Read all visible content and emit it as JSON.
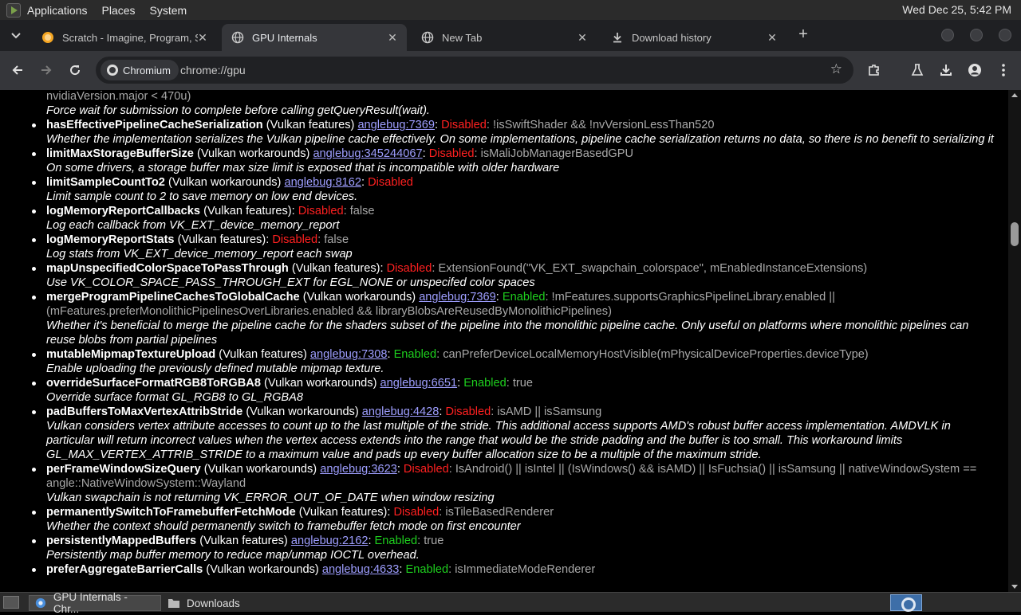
{
  "system_panel": {
    "menus": [
      "Applications",
      "Places",
      "System"
    ],
    "clock": "Wed Dec 25,  5:42 PM"
  },
  "tabs": [
    {
      "title": "Scratch - Imagine, Program, Share",
      "icon": "scratch-icon",
      "active": false
    },
    {
      "title": "GPU Internals",
      "icon": "globe-icon",
      "active": true
    },
    {
      "title": "New Tab",
      "icon": "globe-icon",
      "active": false
    },
    {
      "title": "Download history",
      "icon": "download-icon",
      "active": false
    }
  ],
  "toolbar": {
    "chip_label": "Chromium",
    "url": "chrome://gpu"
  },
  "content": {
    "top_partial_cond": "nvidiaVersion.major < 470u)",
    "top_partial_desc": "Force wait for submission to complete before calling getQueryResult(wait).",
    "features": [
      {
        "name": "hasEffectivePipelineCacheSerialization",
        "kind": "(Vulkan features)",
        "link": "anglebug:7369",
        "status": "Disabled",
        "cond": "!isSwiftShader && !nvVersionLessThan520",
        "desc": "Whether the implementation serializes the Vulkan pipeline cache effectively. On some implementations, pipeline cache serialization returns no data, so there is no benefit to serializing it"
      },
      {
        "name": "limitMaxStorageBufferSize",
        "kind": "(Vulkan workarounds)",
        "link": "anglebug:345244067",
        "status": "Disabled",
        "cond": "isMaliJobManagerBasedGPU",
        "desc": "On some drivers, a storage buffer max size limit is exposed that is incompatible with older hardware"
      },
      {
        "name": "limitSampleCountTo2",
        "kind": "(Vulkan workarounds)",
        "link": "anglebug:8162",
        "status": "Disabled",
        "cond": "",
        "desc": "Limit sample count to 2 to save memory on low end devices."
      },
      {
        "name": "logMemoryReportCallbacks",
        "kind": "(Vulkan features):",
        "link": "",
        "status": "Disabled",
        "cond": "false",
        "desc": "Log each callback from VK_EXT_device_memory_report"
      },
      {
        "name": "logMemoryReportStats",
        "kind": "(Vulkan features):",
        "link": "",
        "status": "Disabled",
        "cond": "false",
        "desc": "Log stats from VK_EXT_device_memory_report each swap"
      },
      {
        "name": "mapUnspecifiedColorSpaceToPassThrough",
        "kind": "(Vulkan features):",
        "link": "",
        "status": "Disabled",
        "cond": "ExtensionFound(\"VK_EXT_swapchain_colorspace\", mEnabledInstanceExtensions)",
        "desc": "Use VK_COLOR_SPACE_PASS_THROUGH_EXT for EGL_NONE or unspecifed color spaces"
      },
      {
        "name": "mergeProgramPipelineCachesToGlobalCache",
        "kind": "(Vulkan workarounds)",
        "link": "anglebug:7369",
        "status": "Enabled",
        "cond": "!mFeatures.supportsGraphicsPipelineLibrary.enabled || (mFeatures.preferMonolithicPipelinesOverLibraries.enabled && libraryBlobsAreReusedByMonolithicPipelines)",
        "desc": "Whether it's beneficial to merge the pipeline cache for the shaders subset of the pipeline into the monolithic pipeline cache. Only useful on platforms where monolithic pipelines can reuse blobs from partial pipelines"
      },
      {
        "name": "mutableMipmapTextureUpload",
        "kind": "(Vulkan features)",
        "link": "anglebug:7308",
        "status": "Enabled",
        "cond": "canPreferDeviceLocalMemoryHostVisible(mPhysicalDeviceProperties.deviceType)",
        "desc": "Enable uploading the previously defined mutable mipmap texture."
      },
      {
        "name": "overrideSurfaceFormatRGB8ToRGBA8",
        "kind": "(Vulkan workarounds)",
        "link": "anglebug:6651",
        "status": "Enabled",
        "cond": "true",
        "desc": "Override surface format GL_RGB8 to GL_RGBA8"
      },
      {
        "name": "padBuffersToMaxVertexAttribStride",
        "kind": "(Vulkan workarounds)",
        "link": "anglebug:4428",
        "status": "Disabled",
        "cond": "isAMD || isSamsung",
        "desc": "Vulkan considers vertex attribute accesses to count up to the last multiple of the stride. This additional access supports AMD's robust buffer access implementation. AMDVLK in particular will return incorrect values when the vertex access extends into the range that would be the stride padding and the buffer is too small. This workaround limits GL_MAX_VERTEX_ATTRIB_STRIDE to a maximum value and pads up every buffer allocation size to be a multiple of the maximum stride."
      },
      {
        "name": "perFrameWindowSizeQuery",
        "kind": "(Vulkan workarounds)",
        "link": "anglebug:3623",
        "status": "Disabled",
        "cond": "IsAndroid() || isIntel || (IsWindows() && isAMD) || IsFuchsia() || isSamsung || nativeWindowSystem == angle::NativeWindowSystem::Wayland",
        "desc": "Vulkan swapchain is not returning VK_ERROR_OUT_OF_DATE when window resizing"
      },
      {
        "name": "permanentlySwitchToFramebufferFetchMode",
        "kind": "(Vulkan features):",
        "link": "",
        "status": "Disabled",
        "cond": "isTileBasedRenderer",
        "desc": "Whether the context should permanently switch to framebuffer fetch mode on first encounter"
      },
      {
        "name": "persistentlyMappedBuffers",
        "kind": "(Vulkan features)",
        "link": "anglebug:2162",
        "status": "Enabled",
        "cond": "true",
        "desc": "Persistently map buffer memory to reduce map/unmap IOCTL overhead."
      },
      {
        "name": "preferAggregateBarrierCalls",
        "kind": "(Vulkan workarounds)",
        "link": "anglebug:4633",
        "status": "Enabled",
        "cond": "isImmediateModeRenderer",
        "desc": ""
      }
    ]
  },
  "taskbar": {
    "items": [
      {
        "label": "GPU Internals - Chr...",
        "icon": "chromium-icon",
        "active": true
      },
      {
        "label": "Downloads",
        "icon": "folder-icon",
        "active": false
      }
    ]
  },
  "colors": {
    "disabled": "#ff2020",
    "enabled": "#1ed01e",
    "link": "#9e9eff",
    "condition": "#a8a8a8"
  }
}
